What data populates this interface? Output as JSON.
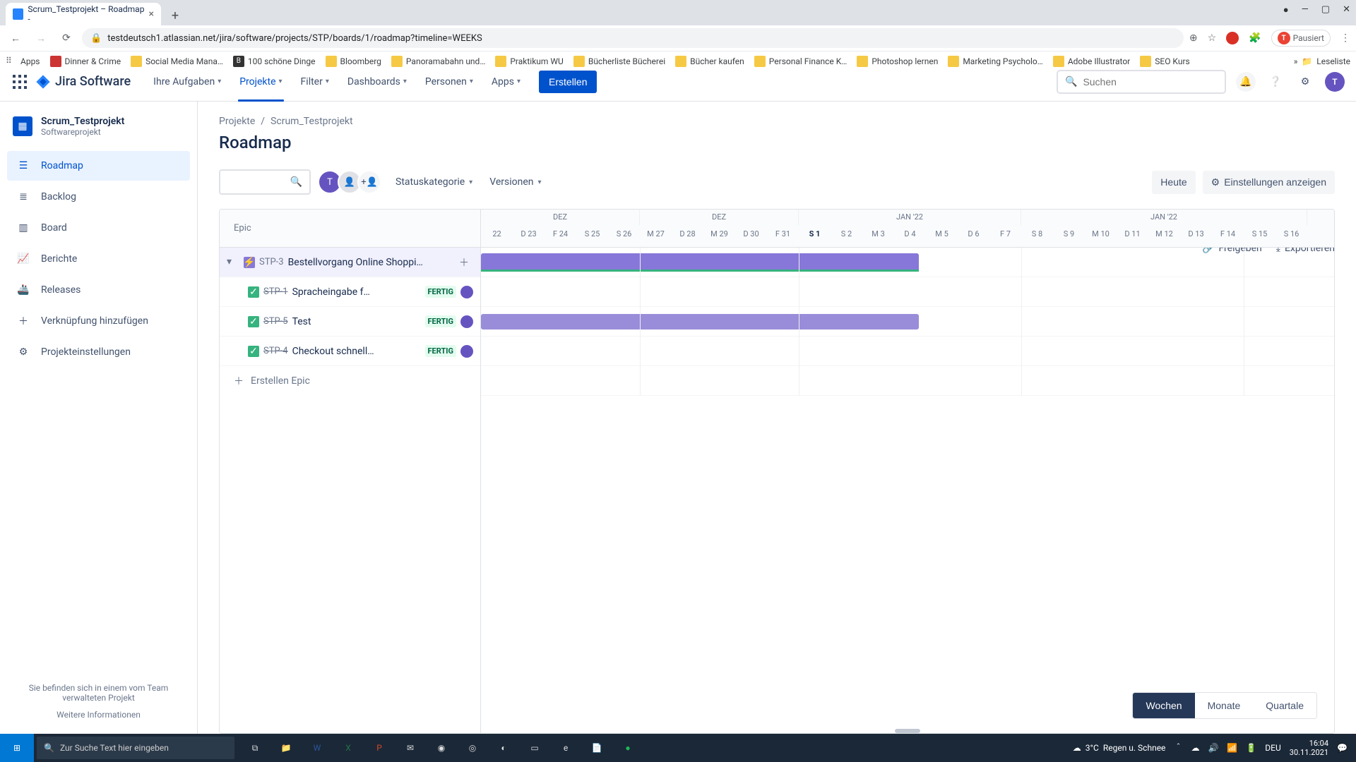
{
  "browser": {
    "tab_title": "Scrum_Testprojekt – Roadmap - ",
    "url": "testdeutsch1.atlassian.net/jira/software/projects/STP/boards/1/roadmap?timeline=WEEKS",
    "pause_label": "Pausiert",
    "bookmarks": [
      "Apps",
      "Dinner & Crime",
      "Social Media Mana…",
      "100 schöne Dinge",
      "Bloomberg",
      "Panoramabahn und…",
      "Praktikum WU",
      "Bücherliste Bücherei",
      "Bücher kaufen",
      "Personal Finance K…",
      "Photoshop lernen",
      "Marketing Psycholo…",
      "Adobe Illustrator",
      "SEO Kurs"
    ],
    "reading_list": "Leseliste"
  },
  "jira_nav": {
    "product": "Jira Software",
    "items": [
      "Ihre Aufgaben",
      "Projekte",
      "Filter",
      "Dashboards",
      "Personen",
      "Apps"
    ],
    "active_index": 1,
    "create": "Erstellen",
    "search_placeholder": "Suchen"
  },
  "sidebar": {
    "project_name": "Scrum_Testprojekt",
    "project_type": "Softwareprojekt",
    "items": [
      "Roadmap",
      "Backlog",
      "Board",
      "Berichte",
      "Releases",
      "Verknüpfung hinzufügen",
      "Projekteinstellungen"
    ],
    "active_index": 0,
    "footer_line": "Sie befinden sich in einem vom Team verwalteten Projekt",
    "footer_link": "Weitere Informationen"
  },
  "breadcrumb": {
    "projects": "Projekte",
    "project": "Scrum_Testprojekt"
  },
  "page": {
    "title": "Roadmap",
    "share": "Freigeben",
    "export": "Exportieren",
    "status_category": "Statuskategorie",
    "versions": "Versionen",
    "today": "Heute",
    "show_settings": "Einstellungen anzeigen"
  },
  "roadmap": {
    "column_header": "Epic",
    "epic": {
      "key": "STP-3",
      "summary": "Bestellvorgang Online Shoppi…"
    },
    "children": [
      {
        "key": "STP-1",
        "summary": "Spracheingabe f…",
        "status": "FERTIG"
      },
      {
        "key": "STP-5",
        "summary": "Test",
        "status": "FERTIG"
      },
      {
        "key": "STP-4",
        "summary": "Checkout schnell…",
        "status": "FERTIG"
      }
    ],
    "create_epic": "Erstellen Epic",
    "months": [
      "DEZ",
      "DEZ",
      "JAN '22",
      "JAN '22"
    ],
    "days": [
      "22",
      "D 23",
      "F 24",
      "S 25",
      "S 26",
      "M 27",
      "D 28",
      "M 29",
      "D 30",
      "F 31",
      "S 1",
      "S 2",
      "M 3",
      "D 4",
      "M 5",
      "D 6",
      "F 7",
      "S 8",
      "S 9",
      "M 10",
      "D 11",
      "M 12",
      "D 13",
      "F 14",
      "S 15",
      "S 16"
    ],
    "today_index": 10
  },
  "zoom": {
    "weeks": "Wochen",
    "months": "Monate",
    "quarters": "Quartale"
  },
  "taskbar": {
    "search_placeholder": "Zur Suche Text hier eingeben",
    "weather_temp": "3°C",
    "weather_text": "Regen u. Schnee",
    "lang": "DEU",
    "time": "16:04",
    "date": "30.11.2021"
  }
}
